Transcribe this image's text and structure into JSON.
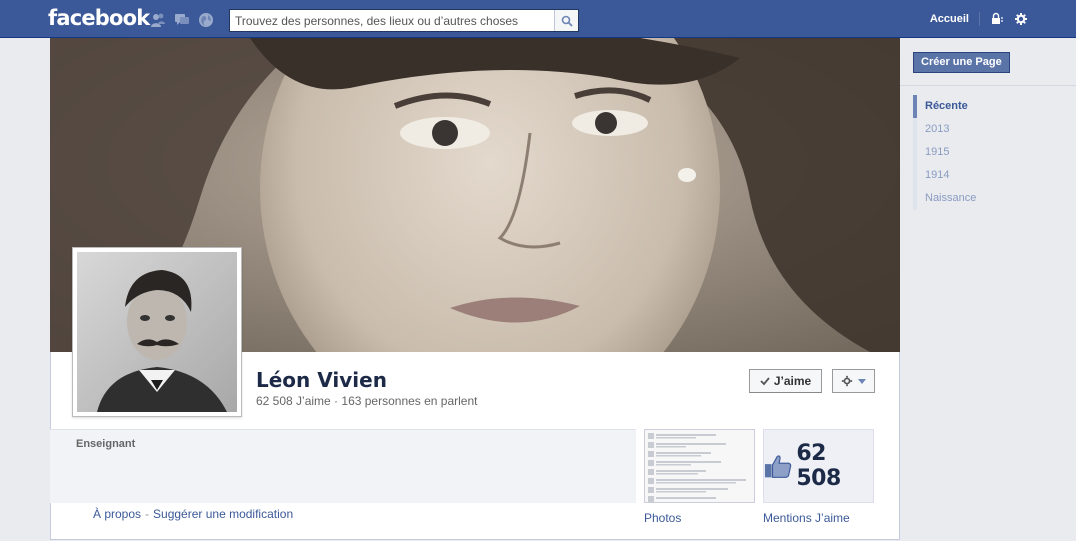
{
  "topbar": {
    "logo": "facebook",
    "search_placeholder": "Trouvez des personnes, des lieux ou d’autres choses",
    "home_label": "Accueil"
  },
  "page": {
    "name": "Léon Vivien",
    "likes_text": "62 508 J’aime",
    "separator": " · ",
    "talking_text": "163 personnes en parlent",
    "category": "Enseignant",
    "like_button_label": "J’aime"
  },
  "links": {
    "about": "À propos",
    "separator": "-",
    "suggest": "Suggérer une modification"
  },
  "tiles": {
    "photos_label": "Photos",
    "likes_count": "62 508",
    "likes_label": "Mentions J’aime"
  },
  "sidebar": {
    "create_page": "Créer une Page",
    "years": [
      {
        "label": "Récente",
        "active": true
      },
      {
        "label": "2013"
      },
      {
        "label": "1915"
      },
      {
        "label": "1914"
      },
      {
        "label": "Naissance"
      }
    ]
  },
  "colors": {
    "brand": "#3b5998",
    "link": "#3b5998",
    "active_year": "#6d84b4"
  }
}
